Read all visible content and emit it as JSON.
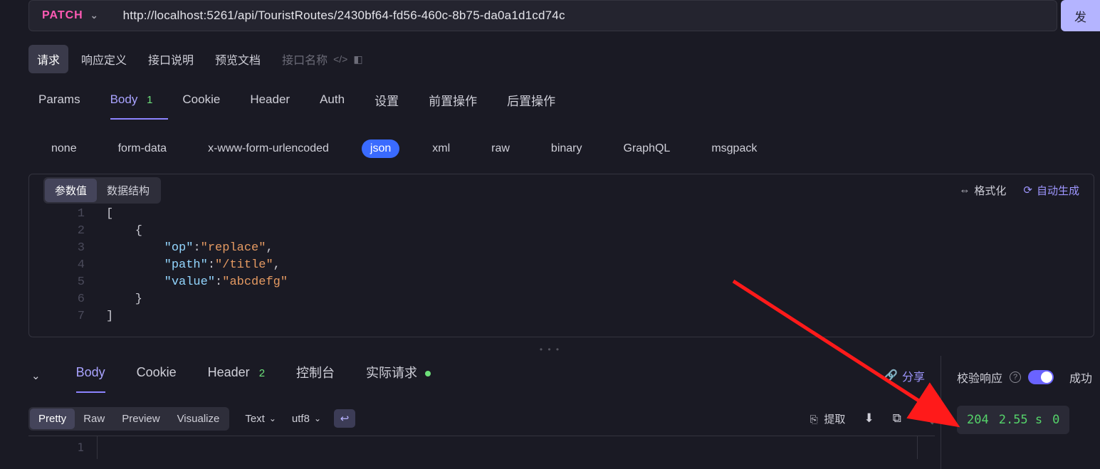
{
  "request": {
    "method": "PATCH",
    "url": "http://localhost:5261/api/TouristRoutes/2430bf64-fd56-460c-8b75-da0a1d1cd74c",
    "send_label": "发"
  },
  "top_tabs": {
    "items": [
      "请求",
      "响应定义",
      "接口说明",
      "预览文档"
    ],
    "active_index": 0,
    "name_placeholder": "接口名称"
  },
  "req_tabs": {
    "items": [
      "Params",
      "Body",
      "Cookie",
      "Header",
      "Auth",
      "设置",
      "前置操作",
      "后置操作"
    ],
    "active_index": 1,
    "body_badge": "1"
  },
  "body_types": {
    "items": [
      "none",
      "form-data",
      "x-www-form-urlencoded",
      "json",
      "xml",
      "raw",
      "binary",
      "GraphQL",
      "msgpack"
    ],
    "active_index": 3
  },
  "editor_head": {
    "segments": [
      "参数值",
      "数据结构"
    ],
    "active_index": 0,
    "format_label": "格式化",
    "autogen_label": "自动生成"
  },
  "body_json": [
    {
      "op": "replace",
      "path": "/title",
      "value": "abcdefg"
    }
  ],
  "code_lines": [
    "[",
    "    {",
    "        \"op\":\"replace\",",
    "        \"path\":\"/title\",",
    "        \"value\":\"abcdefg\"",
    "    }",
    "]"
  ],
  "response_tabs": {
    "items": [
      "Body",
      "Cookie",
      "Header",
      "控制台",
      "实际请求"
    ],
    "active_index": 0,
    "header_badge": "2",
    "share_label": "分享"
  },
  "resp_view": {
    "segments": [
      "Pretty",
      "Raw",
      "Preview",
      "Visualize"
    ],
    "active_index": 0,
    "format": "Text",
    "encoding": "utf8",
    "extract_label": "提取"
  },
  "resp_body_lines": [
    ""
  ],
  "right": {
    "validate_label": "校验响应",
    "success_label": "成功",
    "status_code": "204",
    "time": "2.55 s",
    "size": "0"
  }
}
